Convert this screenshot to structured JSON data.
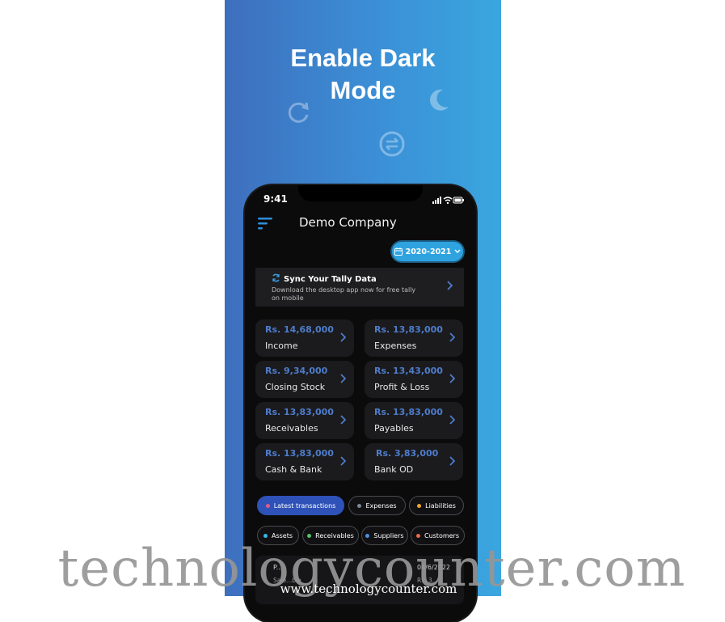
{
  "promo": {
    "headline_line1": "Enable Dark",
    "headline_line2": "Mode",
    "background_colors": [
      "#3e6fbe",
      "#3aa6df"
    ]
  },
  "status_bar": {
    "time": "9:41",
    "icons": [
      "cellular-signal-icon",
      "wifi-icon",
      "battery-icon"
    ]
  },
  "header": {
    "menu_icon": "menu-icon",
    "company_name": "Demo Company",
    "year_selector": {
      "icon": "calendar-icon",
      "label": "2020-2021",
      "caret": "chevron-down-icon"
    }
  },
  "sync_card": {
    "icon": "sync-icon",
    "title": "Sync Your Tally Data",
    "description": "Download the desktop app now for free tally on mobile"
  },
  "summary_tiles": [
    {
      "amount": "Rs. 14,68,000",
      "label": "Income"
    },
    {
      "amount": "Rs. 13,83,000",
      "label": "Expenses"
    },
    {
      "amount": "Rs. 9,34,000",
      "label": "Closing Stock"
    },
    {
      "amount": "Rs. 13,43,000",
      "label": "Profit & Loss"
    },
    {
      "amount": "Rs. 13,83,000",
      "label": "Receivables"
    },
    {
      "amount": "Rs. 13,83,000",
      "label": "Payables"
    },
    {
      "amount": "Rs. 13,83,000",
      "label": "Cash & Bank"
    },
    {
      "amount": "Rs. 3,83,000",
      "label": "Bank OD"
    }
  ],
  "filter_chips": [
    {
      "label": "Latest transactions",
      "dot_color": "#e05a8a",
      "active": true
    },
    {
      "label": "Expenses",
      "dot_color": "#7d8596",
      "active": false
    },
    {
      "label": "Liabilities",
      "dot_color": "#f0a52a",
      "active": false
    },
    {
      "label": "Assets",
      "dot_color": "#38b8e6",
      "active": false
    },
    {
      "label": "Receivables",
      "dot_color": "#4cc46a",
      "active": false
    },
    {
      "label": "Suppliers",
      "dot_color": "#4f8fe0",
      "active": false
    },
    {
      "label": "Customers",
      "dot_color": "#e86a4a",
      "active": false
    }
  ],
  "transaction_preview": {
    "name": "P...",
    "type": "Sale...ble",
    "date": "04/6/2022",
    "amount": "Rs. 3..."
  },
  "watermark": {
    "big": "technologycounter.com",
    "small": "www.technologycounter.com"
  },
  "colors": {
    "accent": "#2ea3e0",
    "amount_blue": "#4e7ccc",
    "active_chip": "#2f52b8",
    "phone_bg": "#0b0b0c",
    "tile_bg": "#1b1b1d"
  }
}
